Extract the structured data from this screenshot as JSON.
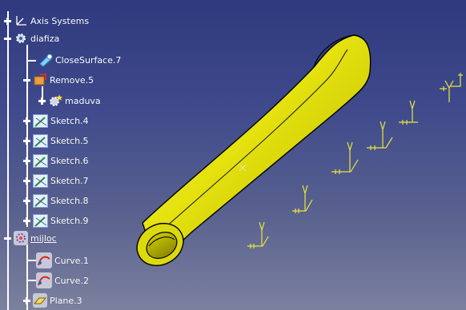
{
  "tree": {
    "nodes": [
      {
        "id": "axis",
        "label": "Axis Systems"
      },
      {
        "id": "diafiza",
        "label": "diafiza"
      },
      {
        "id": "closesurface",
        "label": "CloseSurface.7"
      },
      {
        "id": "remove",
        "label": "Remove.5"
      },
      {
        "id": "maduva",
        "label": "maduva"
      },
      {
        "id": "sketch4",
        "label": "Sketch.4"
      },
      {
        "id": "sketch5",
        "label": "Sketch.5"
      },
      {
        "id": "sketch6",
        "label": "Sketch.6"
      },
      {
        "id": "sketch7",
        "label": "Sketch.7"
      },
      {
        "id": "sketch8",
        "label": "Sketch.8"
      },
      {
        "id": "sketch9",
        "label": "Sketch.9"
      },
      {
        "id": "mijloc",
        "label": "mijloc"
      },
      {
        "id": "curve1",
        "label": "Curve.1"
      },
      {
        "id": "curve2",
        "label": "Curve.2"
      },
      {
        "id": "plane3",
        "label": "Plane.3"
      }
    ]
  },
  "colors": {
    "background_top": "#2f3a7e",
    "background_bottom": "#7c819e",
    "tube_fill": "#e3e10e",
    "sketch_axis": "#e8e83a"
  },
  "icons": {
    "axis": "axis-system-icon",
    "part": "gear-part-icon",
    "surface": "close-surface-icon",
    "remove": "remove-icon",
    "body": "body-icon",
    "sketch": "sketch-icon",
    "geoset": "geometrical-set-icon",
    "curve": "curve-icon",
    "plane": "plane-icon"
  }
}
